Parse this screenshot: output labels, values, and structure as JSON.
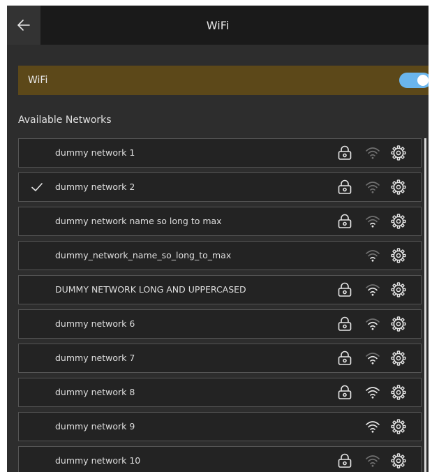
{
  "header": {
    "title": "WiFi",
    "back_icon": "arrow-left-icon"
  },
  "wifi_toggle": {
    "label": "WiFi",
    "enabled": true,
    "accent_color": "#6ab5ec",
    "row_color": "#5c4819"
  },
  "section": {
    "title": "Available Networks"
  },
  "networks": [
    {
      "name": "dummy network 1",
      "connected": false,
      "secured": true,
      "signal_bars": 0
    },
    {
      "name": "dummy network 2",
      "connected": true,
      "secured": true,
      "signal_bars": 0
    },
    {
      "name": "dummy network name so long to max",
      "connected": false,
      "secured": true,
      "signal_bars": 1
    },
    {
      "name": "dummy_network_name_so_long_to_max",
      "connected": false,
      "secured": false,
      "signal_bars": 1
    },
    {
      "name": "DUMMY NETWORK LONG AND UPPERCASED",
      "connected": false,
      "secured": true,
      "signal_bars": 2
    },
    {
      "name": "dummy network 6",
      "connected": false,
      "secured": true,
      "signal_bars": 2
    },
    {
      "name": "dummy network 7",
      "connected": false,
      "secured": true,
      "signal_bars": 2
    },
    {
      "name": "dummy network 8",
      "connected": false,
      "secured": true,
      "signal_bars": 3
    },
    {
      "name": "dummy network 9",
      "connected": false,
      "secured": false,
      "signal_bars": 3
    },
    {
      "name": "dummy network 10",
      "connected": false,
      "secured": true,
      "signal_bars": 0
    }
  ],
  "icons": {
    "connected": "checkmark-icon",
    "secured": "lock-icon",
    "signal": "wifi-signal-icon",
    "settings": "gear-icon"
  }
}
